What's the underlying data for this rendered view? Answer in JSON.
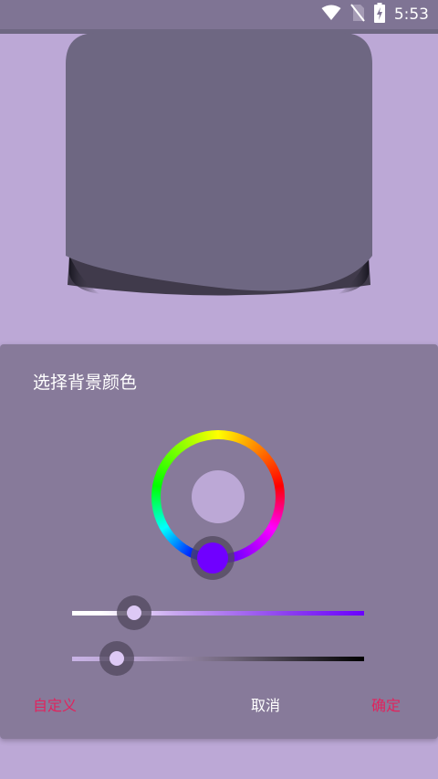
{
  "status_bar": {
    "time": "5:53",
    "icons": [
      "wifi-icon",
      "no-sim-icon",
      "battery-charging-icon"
    ]
  },
  "dialog": {
    "title": "选择背景颜色",
    "buttons": {
      "custom": "自定义",
      "cancel": "取消",
      "ok": "确定"
    },
    "selected_hue_color": "#7000ff",
    "preview_color": "#bca8d6",
    "saturation_level": 0.21,
    "value_level": 0.15
  },
  "colors": {
    "background": "#bca8d6",
    "dialog": "#877a9a",
    "accent": "#e0245e",
    "status_bar": "#7f7494",
    "preview_card": "#6e6782"
  }
}
